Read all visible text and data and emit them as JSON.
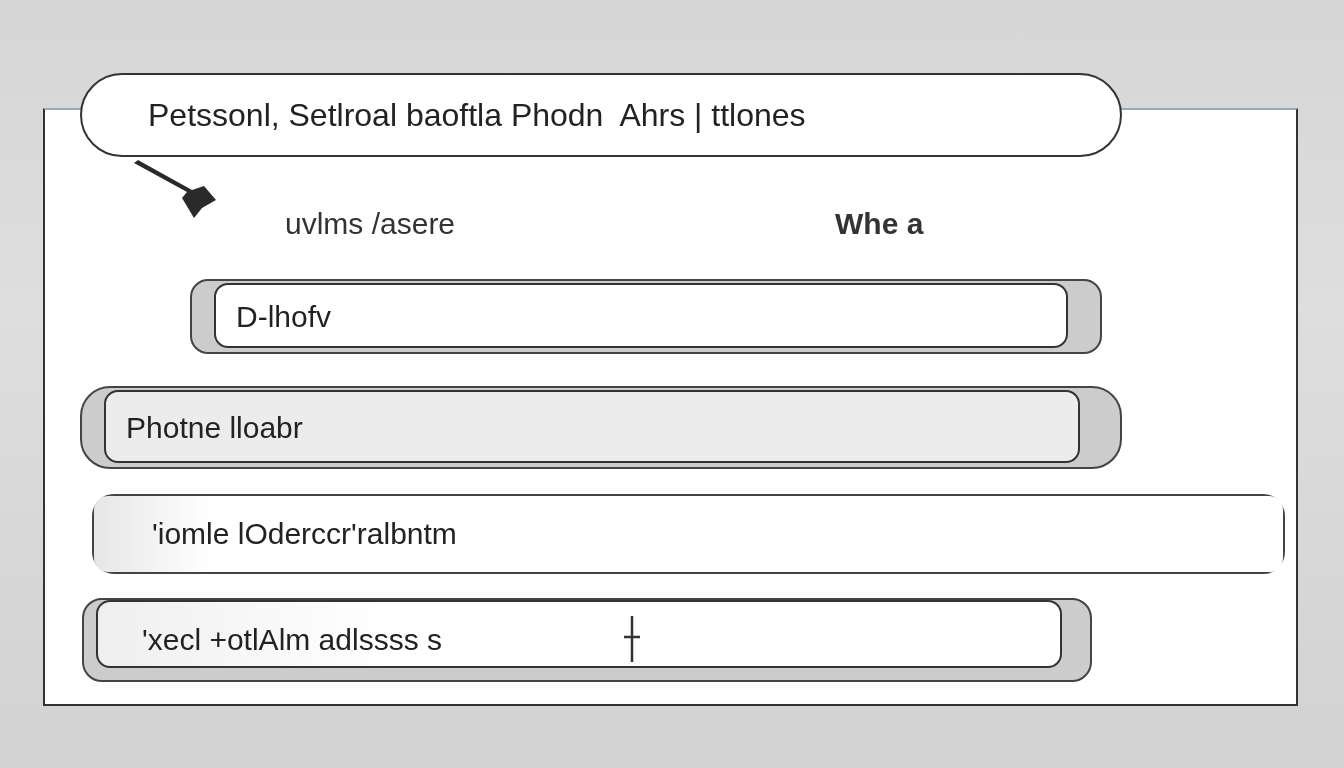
{
  "title": "Petssonl, Setlroal baoftla Phodn  Ahrs | ttlones",
  "columns": [
    "uvlms /asere",
    "Whe a"
  ],
  "fields": [
    {
      "value": "D-lhofv"
    },
    {
      "value": "Photne lloabr"
    },
    {
      "value": "'iomle lOderccr'ralbntm"
    },
    {
      "value": "'xecl +otlAlm adlssss s"
    }
  ]
}
